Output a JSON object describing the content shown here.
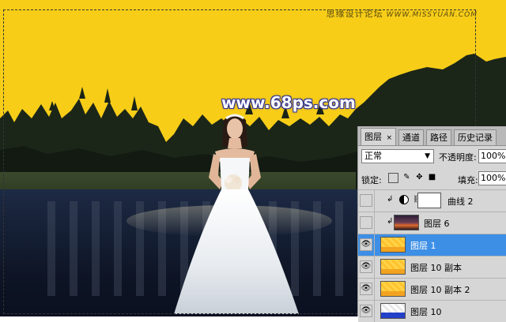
{
  "watermark": {
    "site_cn": "思缘设计论坛",
    "site_url": "WWW.MISSYUAN.COM",
    "center": "www.68ps.com"
  },
  "colors": {
    "sky": "#f7cd18",
    "selected_layer": "#3d8fe6",
    "panel": "#d6d6d6"
  },
  "panel": {
    "tabs": [
      {
        "label": "图层",
        "close": "×",
        "active": true
      },
      {
        "label": "通道"
      },
      {
        "label": "路径"
      },
      {
        "label": "历史记录"
      }
    ],
    "blend_mode": "正常",
    "opacity_label": "不透明度:",
    "opacity_value": "100%",
    "lock_label": "锁定:",
    "fill_label": "填充:",
    "fill_value": "100%",
    "layers": [
      {
        "name": "曲线 2",
        "visible": false,
        "type": "curves-adjustment",
        "clipped": true
      },
      {
        "name": "图层 6",
        "visible": false,
        "type": "image",
        "clipped": true
      },
      {
        "name": "图层 1",
        "visible": true,
        "type": "image",
        "selected": true
      },
      {
        "name": "图层 10 副本",
        "visible": true,
        "type": "image"
      },
      {
        "name": "图层 10 副本 2",
        "visible": true,
        "type": "image"
      },
      {
        "name": "图层 10",
        "visible": true,
        "type": "image"
      }
    ]
  }
}
